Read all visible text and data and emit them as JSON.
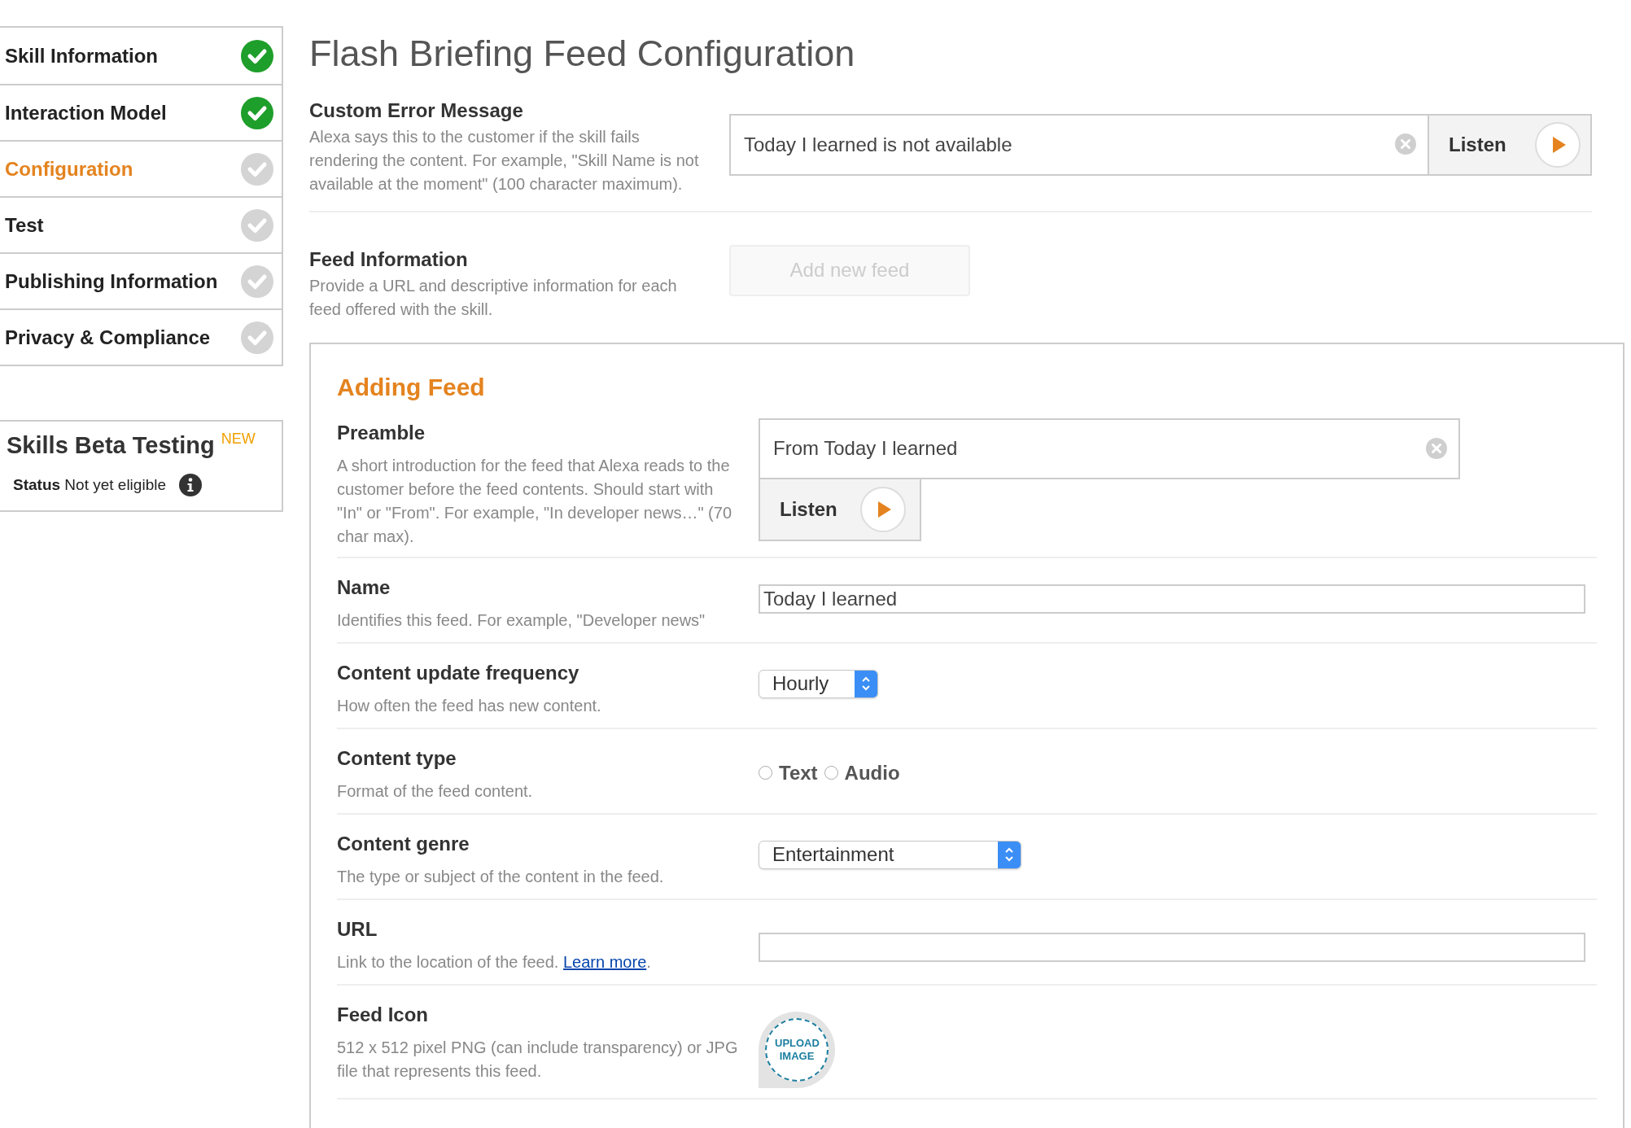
{
  "sidebar": {
    "steps": [
      {
        "label": "Skill Information",
        "completed": true,
        "selected": false
      },
      {
        "label": "Interaction Model",
        "completed": true,
        "selected": false
      },
      {
        "label": "Configuration",
        "completed": false,
        "selected": true
      },
      {
        "label": "Test",
        "completed": false,
        "selected": false
      },
      {
        "label": "Publishing Information",
        "completed": false,
        "selected": false
      },
      {
        "label": "Privacy & Compliance",
        "completed": false,
        "selected": false
      }
    ],
    "beta": {
      "title": "Skills Beta Testing",
      "badge": "NEW",
      "status_label": "Status",
      "status_value": "Not yet eligible"
    }
  },
  "title": "Flash Briefing Feed Configuration",
  "custom_error": {
    "label": "Custom Error Message",
    "description": "Alexa says this to the customer if the skill fails rendering the content. For example, \"Skill Name is not available at the moment\" (100 character maximum).",
    "value": "Today I learned is not available",
    "listen": "Listen"
  },
  "feed_information": {
    "label": "Feed Information",
    "description": "Provide a URL and descriptive information for each feed offered with the skill.",
    "add_button": {
      "label": "Add new feed",
      "disabled": true
    }
  },
  "adding_feed": {
    "heading": "Adding Feed",
    "fields": [
      {
        "kind": "listen",
        "label": "Preamble",
        "description": "A short introduction for the feed that Alexa reads to the customer before the feed contents. Should start with \"In\" or \"From\". For example, \"In developer news…\" (70 char max).",
        "value": "From Today I learned",
        "listen": "Listen"
      },
      {
        "kind": "text",
        "label": "Name",
        "description": "Identifies this feed. For example, \"Developer news\"",
        "value": "Today I learned"
      },
      {
        "kind": "select",
        "label": "Content update frequency",
        "description": "How often the feed has new content.",
        "value": "Hourly"
      },
      {
        "kind": "radio",
        "label": "Content type",
        "description": "Format of the feed content.",
        "options": [
          {
            "label": "Text",
            "selected": false
          },
          {
            "label": "Audio",
            "selected": false
          }
        ]
      },
      {
        "kind": "select",
        "label": "Content genre",
        "description": "The type or subject of the content in the feed.",
        "value": "Entertainment"
      },
      {
        "kind": "url",
        "label": "URL",
        "description": "Link to the location of the feed.",
        "link": "Learn more",
        "after": "."
      },
      {
        "kind": "upload",
        "label": "Feed Icon",
        "description": "512 x 512 pixel PNG (can include transparency) or JPG file that represents this feed.",
        "upload_label": "UPLOAD IMAGE"
      }
    ]
  }
}
